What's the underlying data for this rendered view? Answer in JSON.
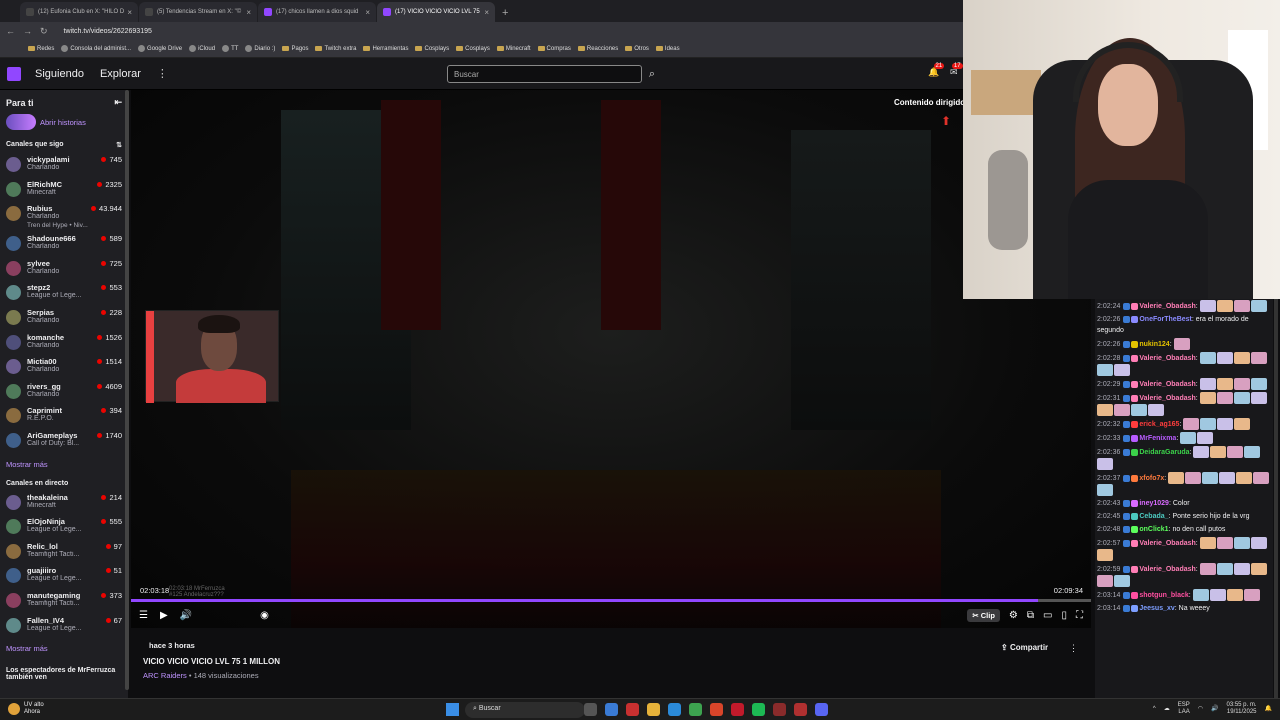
{
  "browser": {
    "tabs": [
      {
        "label": "(12) Eufonia Club en X: \"HILO D",
        "active": false
      },
      {
        "label": "(5) Tendencias Stream en X: \"©",
        "active": false
      },
      {
        "label": "(17) chicos llamen a dios squid",
        "active": false
      },
      {
        "label": "(17) VICIO VICIO VICIO LVL 75",
        "active": true
      }
    ],
    "url": "twitch.tv/videos/2622693195",
    "bookmarks": [
      "Redes",
      "Consola del administ...",
      "Google Drive",
      "iCloud",
      "TT",
      "Diario :)",
      "Pagos",
      "Twitch extra",
      "Herramientas",
      "Cosplays",
      "Cosplays",
      "Minecraft",
      "Compras",
      "Reacciones",
      "Otros",
      "Ideas"
    ]
  },
  "twitch": {
    "nav": {
      "following": "Siguiendo",
      "browse": "Explorar"
    },
    "search_placeholder": "Buscar",
    "badges": {
      "notifications": "21",
      "inbox": "17"
    }
  },
  "sidebar": {
    "header": "Para ti",
    "stories": "Abrir historias",
    "followed_title": "Canales que sigo",
    "followed": [
      {
        "name": "vickypalami",
        "game": "Charlando",
        "viewers": "745"
      },
      {
        "name": "ElRichMC",
        "game": "Minecraft",
        "viewers": "2325"
      },
      {
        "name": "Rubius",
        "game": "Charlando",
        "viewers": "43.944",
        "extra": "Tren del Hype • Niv..."
      },
      {
        "name": "Shadoune666",
        "game": "Charlando",
        "viewers": "589"
      },
      {
        "name": "sylvee",
        "game": "Charlando",
        "viewers": "725"
      },
      {
        "name": "stepz2",
        "game": "League of Lege...",
        "viewers": "553"
      },
      {
        "name": "Serpias",
        "game": "Charlando",
        "viewers": "228"
      },
      {
        "name": "komanche",
        "game": "Charlando",
        "viewers": "1526"
      },
      {
        "name": "Mictia00",
        "game": "Charlando",
        "viewers": "1514"
      },
      {
        "name": "rivers_gg",
        "game": "Charlando",
        "viewers": "4609"
      },
      {
        "name": "Caprimint",
        "game": "R.E.P.O.",
        "viewers": "394"
      },
      {
        "name": "AriGameplays",
        "game": "Call of Duty: Bl...",
        "viewers": "1740"
      }
    ],
    "show_more": "Mostrar más",
    "live_title": "Canales en directo",
    "live": [
      {
        "name": "theakaleina",
        "game": "Minecraft",
        "viewers": "214"
      },
      {
        "name": "ElOjoNinja",
        "game": "League of Lege...",
        "viewers": "555"
      },
      {
        "name": "Relic_lol",
        "game": "Teamfight Tacti...",
        "viewers": "97"
      },
      {
        "name": "guajiiiro",
        "game": "League of Lege...",
        "viewers": "51"
      },
      {
        "name": "manutegaming",
        "game": "Teamfight Tacti...",
        "viewers": "373"
      },
      {
        "name": "Fallen_IV4",
        "game": "League of Lege...",
        "viewers": "67"
      }
    ],
    "show_more_2": "Mostrar más",
    "footer": "Los espectadores de MrFerruzca también ven"
  },
  "player": {
    "content_warning": "Contenido dirigido",
    "time_current": "02:03:18",
    "time_total": "02:09:34",
    "progress_fraction": 0.945,
    "chat_ghost_1": "02:03:18 MrFerruzca",
    "chat_ghost_2": "#125 Andelacruz???",
    "clip_label": "Clip"
  },
  "video_meta": {
    "ago": "hace 3 horas",
    "title": "VICIO VICIO VICIO LVL 75 1 MILLON",
    "category": "ARC Raiders",
    "views": "• 148 visualizaciones",
    "share": "Compartir"
  },
  "chat": [
    {
      "ts": "2:02:24",
      "user": "Valerie_Obadash",
      "color": "#ff7eb6",
      "text": "",
      "emotes": 4
    },
    {
      "ts": "2:02:26",
      "user": "OneForTheBest",
      "color": "#8a8aff",
      "text": "era el morado de segundo",
      "emotes": 0
    },
    {
      "ts": "2:02:26",
      "user": "nukin124",
      "color": "#e3c200",
      "text": "",
      "emotes": 1
    },
    {
      "ts": "2:02:28",
      "user": "Valerie_Obadash",
      "color": "#ff7eb6",
      "text": "",
      "emotes": 6
    },
    {
      "ts": "2:02:29",
      "user": "Valerie_Obadash",
      "color": "#ff7eb6",
      "text": "",
      "emotes": 4
    },
    {
      "ts": "2:02:31",
      "user": "Valerie_Obadash",
      "color": "#ff7eb6",
      "text": "",
      "emotes": 8
    },
    {
      "ts": "2:02:32",
      "user": "erick_ag165",
      "color": "#ff3d3d",
      "text": "",
      "emotes": 4
    },
    {
      "ts": "2:02:33",
      "user": "MrFenixma",
      "color": "#b85cff",
      "text": "",
      "emotes": 2
    },
    {
      "ts": "2:02:36",
      "user": "DeidaraGaruda",
      "color": "#3bd14a",
      "text": "",
      "emotes": 5
    },
    {
      "ts": "2:02:37",
      "user": "xfofo7x",
      "color": "#ff7a3d",
      "text": "",
      "emotes": 7
    },
    {
      "ts": "2:02:43",
      "user": "iney1029",
      "color": "#d96bff",
      "text": "Color",
      "emotes": 0
    },
    {
      "ts": "2:02:45",
      "user": "Cebada_",
      "color": "#4cc9c0",
      "text": "Ponte serio hijo de la vrg",
      "emotes": 0
    },
    {
      "ts": "2:02:48",
      "user": "onClick1",
      "color": "#5cff5c",
      "text": "no den call putos",
      "emotes": 0
    },
    {
      "ts": "2:02:57",
      "user": "Valerie_Obadash",
      "color": "#ff7eb6",
      "text": "",
      "emotes": 5
    },
    {
      "ts": "2:02:59",
      "user": "Valerie_Obadash",
      "color": "#ff7eb6",
      "text": "",
      "emotes": 6
    },
    {
      "ts": "2:03:14",
      "user": "shotgun_black",
      "color": "#ff4fa0",
      "text": "",
      "emotes": 4
    },
    {
      "ts": "2:03:14",
      "user": "Jeesus_xv",
      "color": "#7d9eff",
      "text": "Na weeey",
      "emotes": 0
    }
  ],
  "taskbar": {
    "weather_temp": "UV alto",
    "weather_desc": "Ahora",
    "search": "Buscar",
    "lang_1": "ESP",
    "lang_2": "LAA",
    "time": "03:55 p. m.",
    "date": "19/11/2025"
  }
}
